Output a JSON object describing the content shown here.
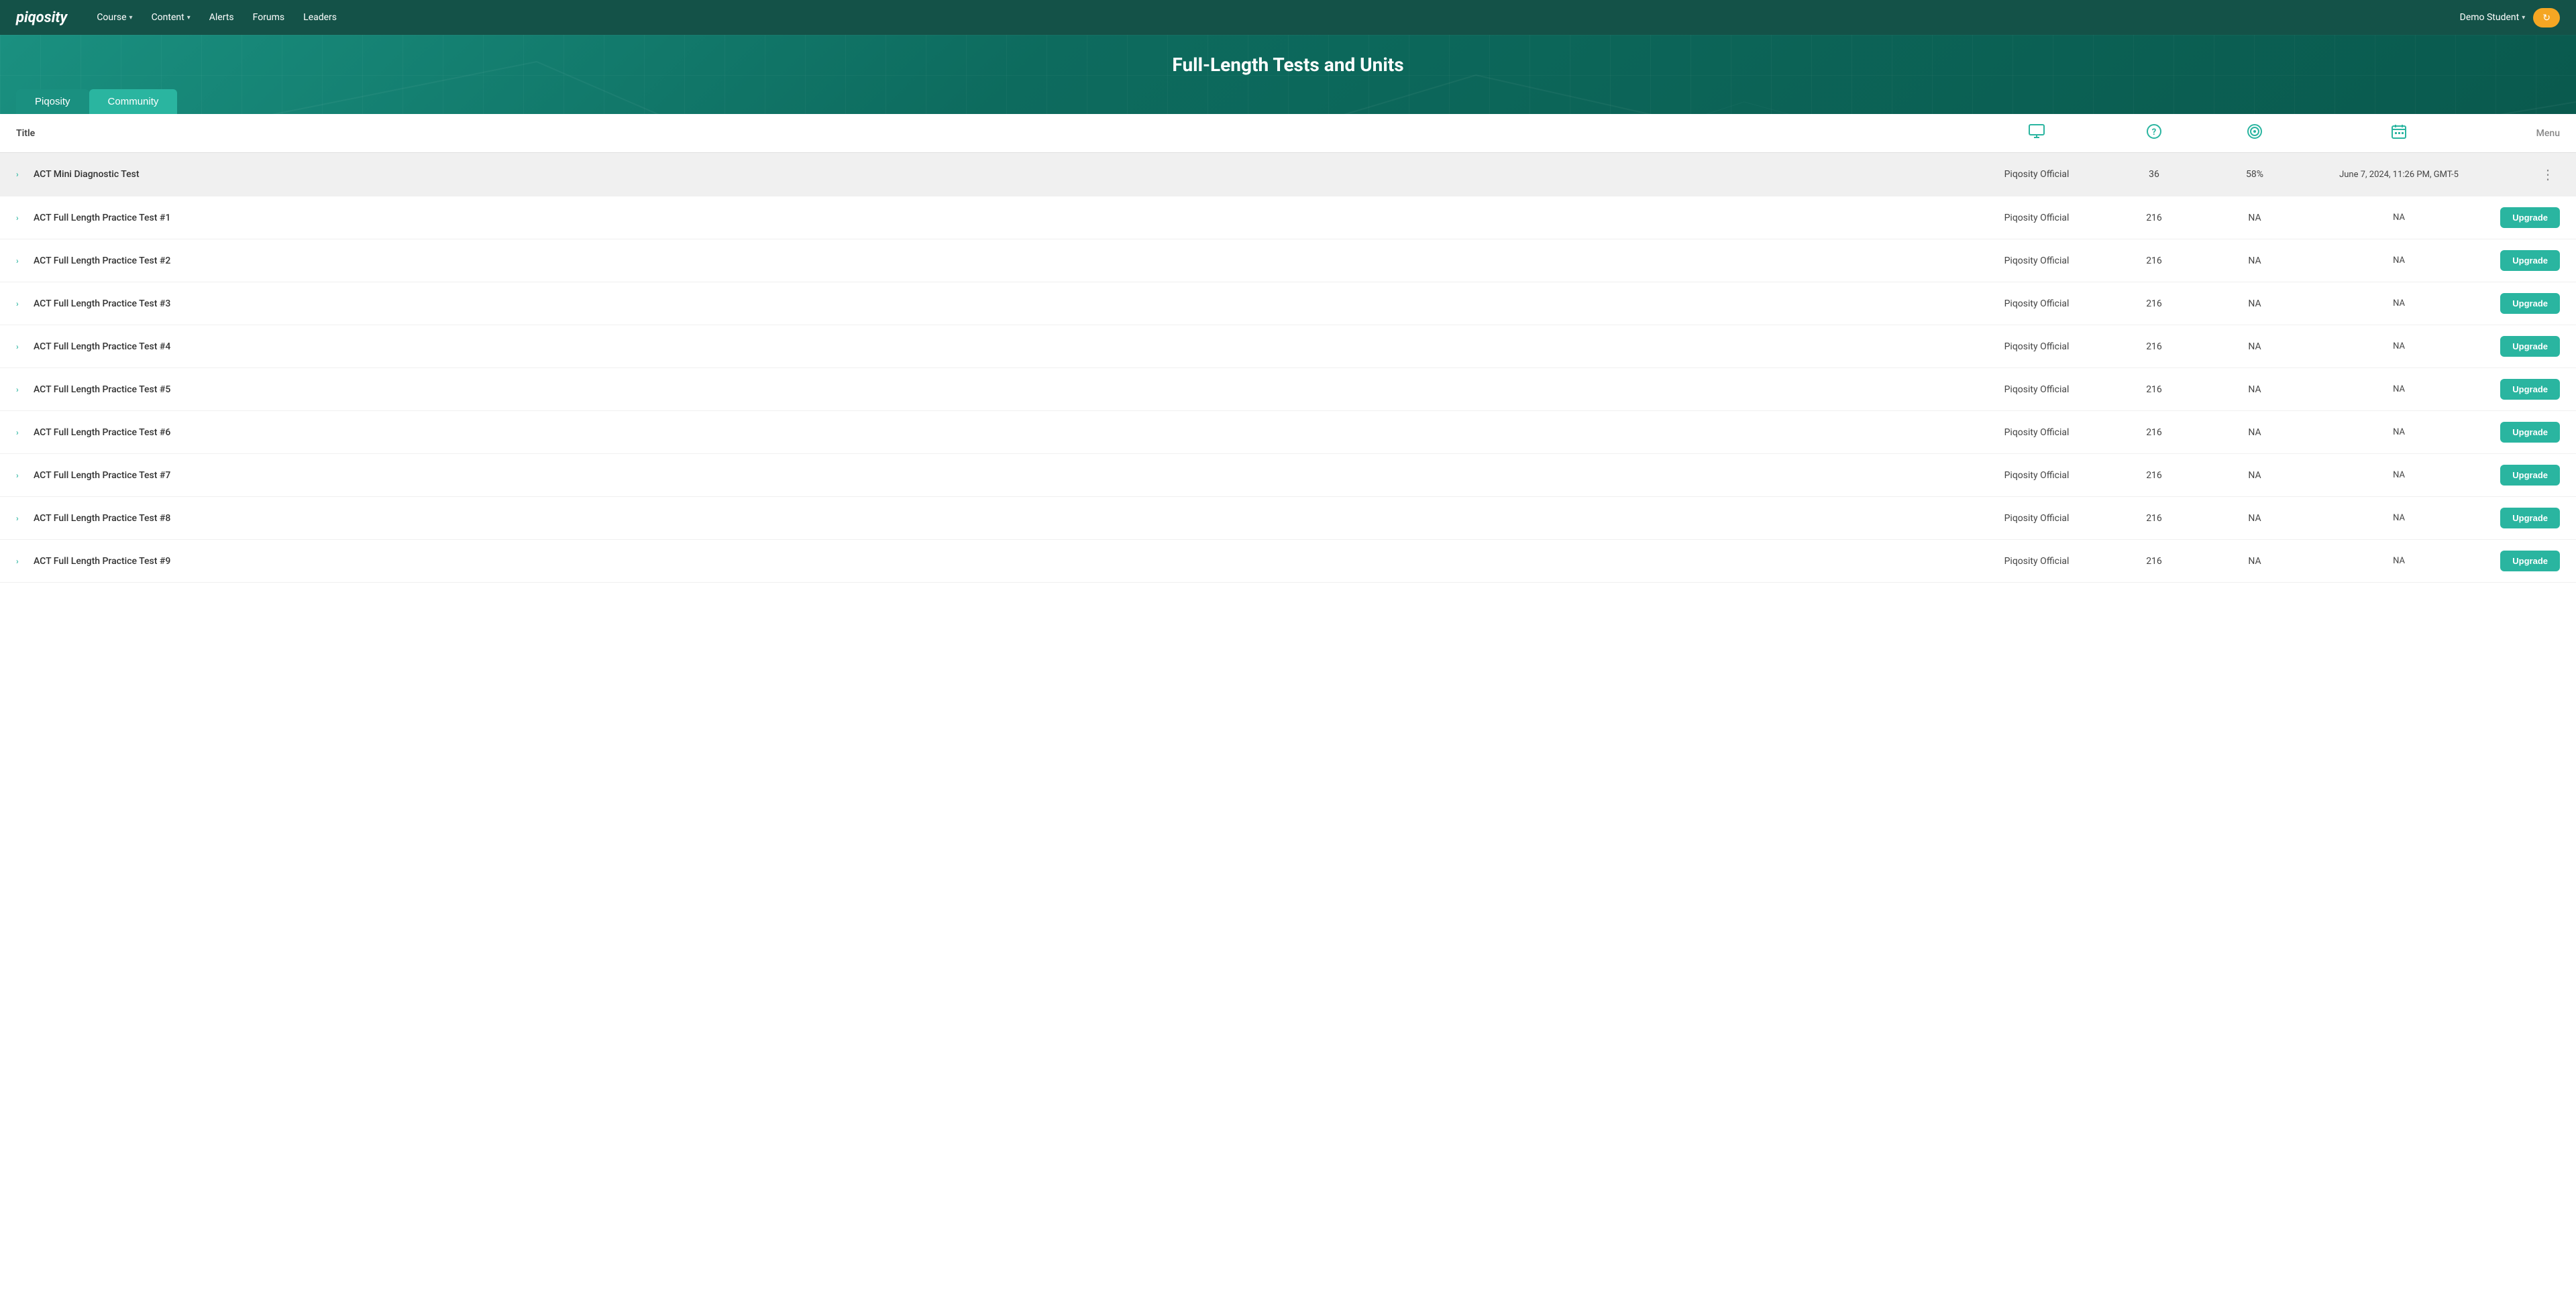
{
  "brand": "piqosity",
  "nav": {
    "items": [
      {
        "label": "Course",
        "hasDropdown": true
      },
      {
        "label": "Content",
        "hasDropdown": true
      },
      {
        "label": "Alerts",
        "hasDropdown": false
      },
      {
        "label": "Forums",
        "hasDropdown": false
      },
      {
        "label": "Leaders",
        "hasDropdown": false
      }
    ]
  },
  "user": {
    "name": "Demo Student",
    "hasDropdown": true
  },
  "sync_button": "↻",
  "page": {
    "title": "Full-Length Tests and Units"
  },
  "tabs": [
    {
      "id": "piqosity",
      "label": "Piqosity",
      "active": false
    },
    {
      "id": "community",
      "label": "Community",
      "active": true
    }
  ],
  "table": {
    "columns": {
      "title": "Title",
      "monitor_icon": "🖥",
      "question_icon": "?",
      "target_icon": "◎",
      "calendar_icon": "📅",
      "menu": "Menu"
    },
    "rows": [
      {
        "id": 1,
        "title": "ACT Mini Diagnostic Test",
        "author": "Piqosity Official",
        "questions": "36",
        "score": "58%",
        "date": "June 7, 2024, 11:26 PM, GMT-5",
        "action": "menu",
        "highlighted": true
      },
      {
        "id": 2,
        "title": "ACT Full Length Practice Test #1",
        "author": "Piqosity Official",
        "questions": "216",
        "score": "NA",
        "date": "NA",
        "action": "upgrade",
        "highlighted": false
      },
      {
        "id": 3,
        "title": "ACT Full Length Practice Test #2",
        "author": "Piqosity Official",
        "questions": "216",
        "score": "NA",
        "date": "NA",
        "action": "upgrade",
        "highlighted": false
      },
      {
        "id": 4,
        "title": "ACT Full Length Practice Test #3",
        "author": "Piqosity Official",
        "questions": "216",
        "score": "NA",
        "date": "NA",
        "action": "upgrade",
        "highlighted": false
      },
      {
        "id": 5,
        "title": "ACT Full Length Practice Test #4",
        "author": "Piqosity Official",
        "questions": "216",
        "score": "NA",
        "date": "NA",
        "action": "upgrade",
        "highlighted": false
      },
      {
        "id": 6,
        "title": "ACT Full Length Practice Test #5",
        "author": "Piqosity Official",
        "questions": "216",
        "score": "NA",
        "date": "NA",
        "action": "upgrade",
        "highlighted": false
      },
      {
        "id": 7,
        "title": "ACT Full Length Practice Test #6",
        "author": "Piqosity Official",
        "questions": "216",
        "score": "NA",
        "date": "NA",
        "action": "upgrade",
        "highlighted": false
      },
      {
        "id": 8,
        "title": "ACT Full Length Practice Test #7",
        "author": "Piqosity Official",
        "questions": "216",
        "score": "NA",
        "date": "NA",
        "action": "upgrade",
        "highlighted": false
      },
      {
        "id": 9,
        "title": "ACT Full Length Practice Test #8",
        "author": "Piqosity Official",
        "questions": "216",
        "score": "NA",
        "date": "NA",
        "action": "upgrade",
        "highlighted": false
      },
      {
        "id": 10,
        "title": "ACT Full Length Practice Test #9",
        "author": "Piqosity Official",
        "questions": "216",
        "score": "NA",
        "date": "NA",
        "action": "upgrade",
        "highlighted": false
      }
    ],
    "upgrade_label": "Upgrade"
  }
}
